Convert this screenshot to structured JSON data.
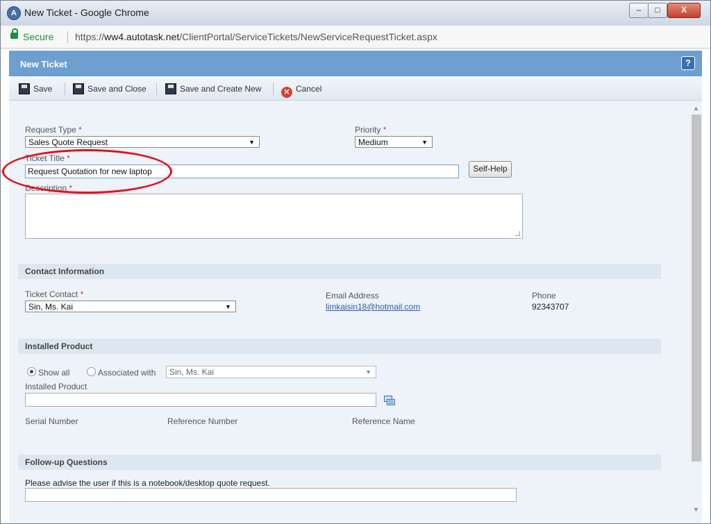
{
  "window": {
    "title": "New Ticket - Google Chrome",
    "minimize": "–",
    "restore": "□",
    "close": "X"
  },
  "addressbar": {
    "secure_label": "Secure",
    "url_prefix": "https://",
    "url_domain": "ww4.autotask.net",
    "url_path": "/ClientPortal/ServiceTickets/NewServiceRequestTicket.aspx"
  },
  "header": {
    "title": "New Ticket",
    "help": "?"
  },
  "toolbar": {
    "save": "Save",
    "save_close": "Save and Close",
    "save_new": "Save and Create New",
    "cancel": "Cancel"
  },
  "form": {
    "request_type_label": "Request Type",
    "request_type_value": "Sales Quote Request",
    "priority_label": "Priority",
    "priority_value": "Medium",
    "ticket_title_label": "Ticket Title",
    "ticket_title_value": "Request Quotation for new laptop",
    "self_help": "Self-Help",
    "description_label": "Description",
    "required_mark": "*"
  },
  "contact": {
    "section": "Contact Information",
    "ticket_contact_label": "Ticket Contact",
    "ticket_contact_value": "Sin, Ms. Kai",
    "email_label": "Email Address",
    "email_value": "limkaisin18@hotmail.com",
    "phone_label": "Phone",
    "phone_value": "92343707"
  },
  "installed": {
    "section": "Installed Product",
    "show_all": "Show all",
    "associated_with": "Associated with",
    "associated_value": "Sin, Ms. Kai",
    "installed_product_label": "Installed Product",
    "serial_label": "Serial Number",
    "reference_number_label": "Reference Number",
    "reference_name_label": "Reference Name"
  },
  "followup": {
    "section": "Follow-up Questions",
    "question1": "Please advise the user if this is a notebook/desktop quote request."
  },
  "colors": {
    "header": "#6d9fd0",
    "accent_circle": "#e3101b",
    "secure": "#1e8e3e"
  }
}
